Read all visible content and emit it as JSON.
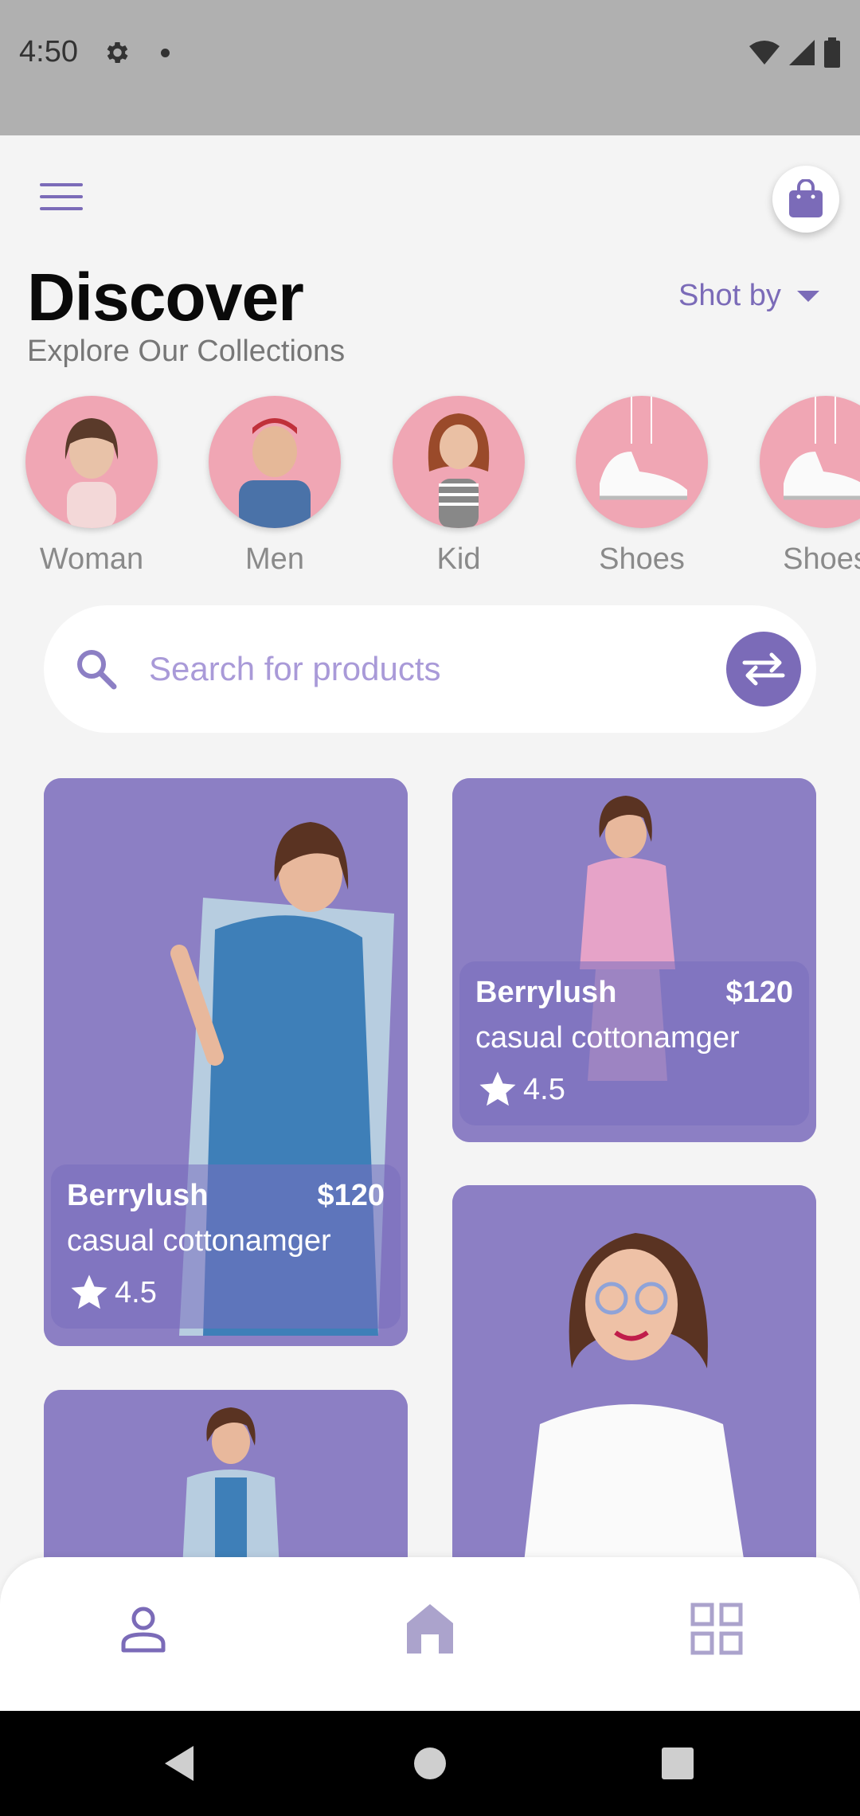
{
  "status_bar": {
    "time": "4:50"
  },
  "header": {
    "title": "Discover",
    "subtitle": "Explore Our Collections",
    "sort_label": "Shot by"
  },
  "categories": [
    {
      "label": "Woman"
    },
    {
      "label": "Men"
    },
    {
      "label": "Kid"
    },
    {
      "label": "Shoes"
    },
    {
      "label": "Shoes"
    }
  ],
  "search": {
    "placeholder": "Search for products"
  },
  "products": [
    {
      "brand": "Berrylush",
      "price": "$120",
      "name": "casual cottonamger",
      "rating": "4.5"
    },
    {
      "brand": "Berrylush",
      "price": "$120",
      "name": "casual cottonamger",
      "rating": "4.5"
    }
  ],
  "colors": {
    "accent": "#7b6bb8",
    "card_bg": "#8c7fc4",
    "category_bg": "#f0a6b4"
  },
  "icons": {
    "menu": "hamburger-icon",
    "bag": "shopping-bag-icon",
    "search": "search-icon",
    "filter": "swap-icon",
    "nav": [
      "person-icon",
      "home-icon",
      "grid-icon"
    ]
  }
}
